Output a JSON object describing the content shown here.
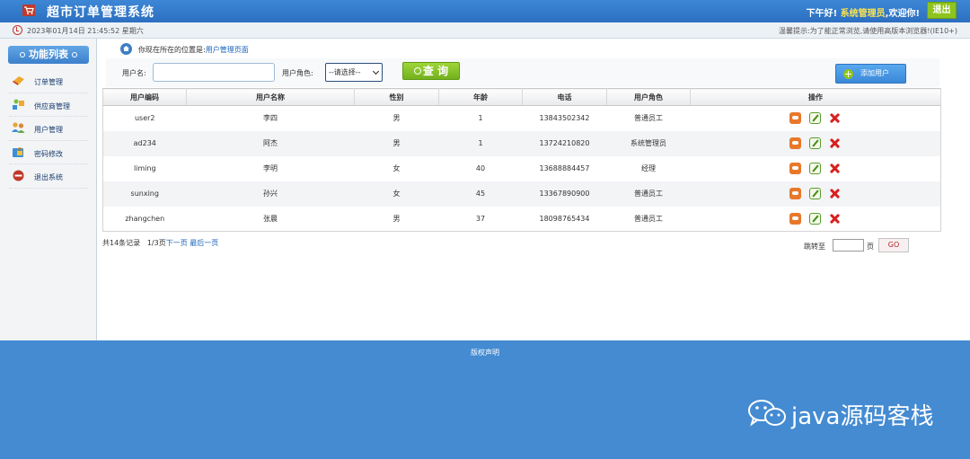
{
  "header": {
    "title": "超市订单管理系统",
    "greeting": "下午好!",
    "user": "系统管理员",
    "welcome": ",欢迎你!",
    "logout_label": "退出"
  },
  "infobar": {
    "datetime": "2023年01月14日 21:45:52 星期六",
    "tip": "温馨提示:为了能正常浏览,请使用高版本浏览器!(IE10+)"
  },
  "sidebar": {
    "header": "功能列表",
    "items": [
      {
        "label": "订单管理",
        "icon": "order-icon"
      },
      {
        "label": "供应商管理",
        "icon": "supplier-icon"
      },
      {
        "label": "用户管理",
        "icon": "users-icon"
      },
      {
        "label": "密码修改",
        "icon": "password-icon"
      },
      {
        "label": "退出系统",
        "icon": "exit-icon"
      }
    ]
  },
  "breadcrumb": {
    "prefix": "你现在所在的位置是:",
    "current": "用户管理页面"
  },
  "search": {
    "username_label": "用户名:",
    "username_value": "",
    "role_label": "用户角色:",
    "role_selected": "--请选择--",
    "query_label": "查 询",
    "add_label": "添加用户"
  },
  "table": {
    "headers": [
      "用户编码",
      "用户名称",
      "性别",
      "年龄",
      "电话",
      "用户角色",
      "操作"
    ],
    "rows": [
      {
        "code": "user2",
        "name": "李四",
        "gender": "男",
        "age": "1",
        "phone": "13843502342",
        "role": "普通员工"
      },
      {
        "code": "ad234",
        "name": "阿杰",
        "gender": "男",
        "age": "1",
        "phone": "13724210820",
        "role": "系统管理员"
      },
      {
        "code": "liming",
        "name": "李明",
        "gender": "女",
        "age": "40",
        "phone": "13688884457",
        "role": "经理"
      },
      {
        "code": "sunxing",
        "name": "孙兴",
        "gender": "女",
        "age": "45",
        "phone": "13367890900",
        "role": "普通员工"
      },
      {
        "code": "zhangchen",
        "name": "张晨",
        "gender": "男",
        "age": "37",
        "phone": "18098765434",
        "role": "普通员工"
      }
    ]
  },
  "pager": {
    "total": "共14条记录",
    "page": "1/3页",
    "next": "下一页",
    "last": "最后一页",
    "jump_label": "跳转至",
    "unit": "页",
    "go_label": "GO"
  },
  "footer": {
    "copyright": "版权声明",
    "watermark": "java源码客栈"
  },
  "colors": {
    "header": "#2c6fc0",
    "accent_green": "#8ec41d",
    "footer": "#448bd2"
  }
}
